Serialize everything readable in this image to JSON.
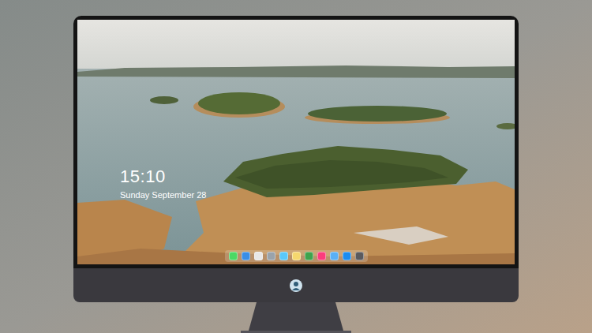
{
  "lock_screen": {
    "time": "15:10",
    "date": "Sunday September 28"
  },
  "dock": {
    "items": [
      {
        "color": "#4cd964"
      },
      {
        "color": "#3a8ee6"
      },
      {
        "color": "#e8e8e8"
      },
      {
        "color": "#9aa3ab"
      },
      {
        "color": "#5ac8fa"
      },
      {
        "color": "#f5d76e"
      },
      {
        "color": "#3fa34d"
      },
      {
        "color": "#fc3c7c"
      },
      {
        "color": "#5ab0f5"
      },
      {
        "color": "#1a8cf0"
      },
      {
        "color": "#5a5a5e"
      }
    ]
  }
}
